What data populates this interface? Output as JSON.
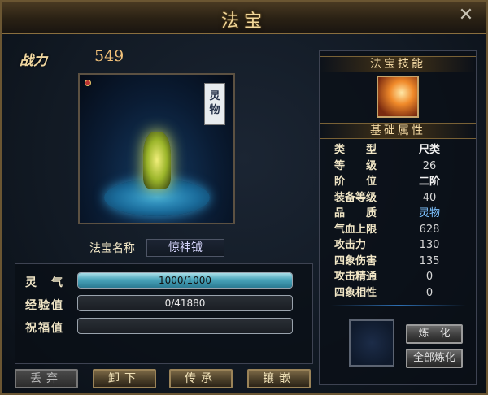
{
  "window": {
    "title": "法宝",
    "close_icon": "close-icon"
  },
  "left": {
    "power_label": "战力",
    "power_value": "549",
    "tag_text": "灵物",
    "name_label": "法宝名称",
    "name_value": "惊神钺"
  },
  "stats": [
    {
      "label": "灵　气",
      "value": "1000/1000",
      "fill": 1.0
    },
    {
      "label": "经验值",
      "value": "0/41880",
      "fill": 0.0
    },
    {
      "label": "祝福值",
      "value": "",
      "fill": 0.0
    }
  ],
  "buttons": {
    "discard": "丢弃",
    "unequip": "卸下",
    "inherit": "传承",
    "inlay": "镶嵌"
  },
  "right": {
    "skill_header": "法宝技能",
    "attr_header": "基础属性",
    "attributes": [
      {
        "label": "类　　型",
        "value": "尺类"
      },
      {
        "label": "等　　级",
        "value": "26"
      },
      {
        "label": "阶　　位",
        "value": "二阶"
      },
      {
        "label": "装备等级",
        "value": "40"
      },
      {
        "label": "品　　质",
        "value": "灵物"
      },
      {
        "label": "气血上限",
        "value": "628"
      },
      {
        "label": "攻击力",
        "value": "130"
      },
      {
        "label": "四象伤害",
        "value": "135"
      },
      {
        "label": "攻击精通",
        "value": "0"
      },
      {
        "label": "四象相性",
        "value": "0"
      }
    ],
    "refine_button": "炼　化",
    "refine_all_button": "全部炼化"
  }
}
